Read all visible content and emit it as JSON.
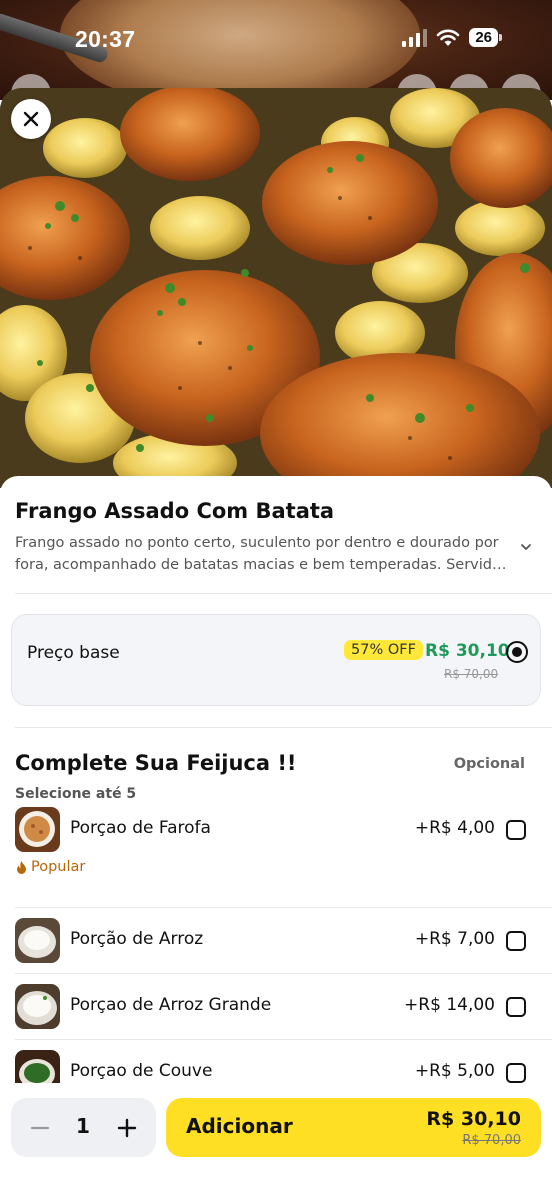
{
  "status_bar": {
    "time": "20:37",
    "battery": "26"
  },
  "product": {
    "title": "Frango Assado Com Batata",
    "description": "Frango assado no ponto certo, suculento por dentro e dourado por fora, acompanhado de batatas macias e bem temperadas. Servido c..."
  },
  "base_option": {
    "label": "Preço base",
    "discount_badge": "57% OFF",
    "price": "R$ 30,10",
    "old_price": "R$ 70,00",
    "selected": true
  },
  "section": {
    "title": "Complete Sua Feijuca !!",
    "optional_label": "Opcional",
    "subtitle": "Selecione até 5"
  },
  "addons": [
    {
      "name": "Porçao de Farofa",
      "price": "+R$ 4,00",
      "tag": "Popular",
      "icon": "farofa-thumbnail"
    },
    {
      "name": "Porção de Arroz",
      "price": "+R$ 7,00",
      "icon": "rice-thumbnail"
    },
    {
      "name": "Porçao de Arroz Grande",
      "price": "+R$ 14,00",
      "icon": "rice-large-thumbnail"
    },
    {
      "name": "Porçao de Couve",
      "price": "+R$ 5,00",
      "icon": "couve-thumbnail"
    }
  ],
  "footer": {
    "quantity": "1",
    "add_label": "Adicionar",
    "total_price": "R$ 30,10",
    "total_old_price": "R$ 70,00"
  },
  "colors": {
    "accent_yellow": "#ffdf24",
    "price_green": "#1e9a5a",
    "popular_orange": "#b8670a",
    "badge_yellow": "#ffe83a"
  }
}
